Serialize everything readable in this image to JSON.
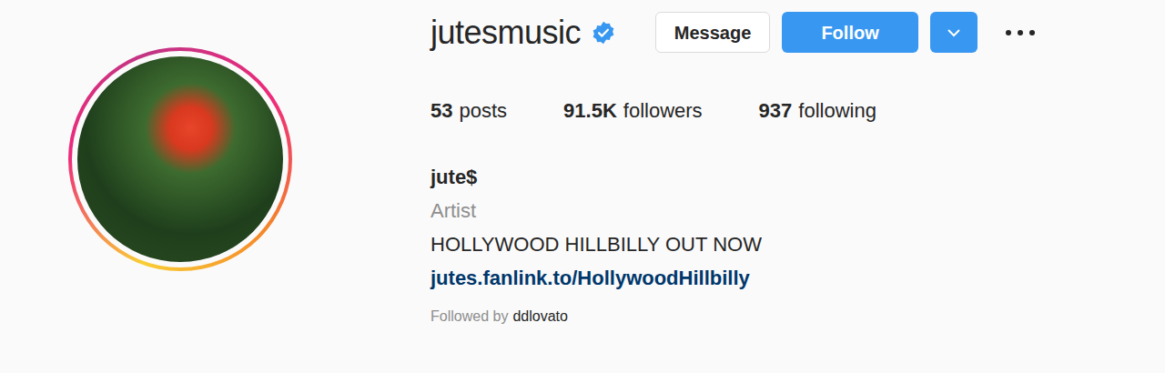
{
  "profile": {
    "username": "jutesmusic",
    "verified": true
  },
  "actions": {
    "message": "Message",
    "follow": "Follow"
  },
  "stats": [
    {
      "value": "53",
      "label": "posts"
    },
    {
      "value": "91.5K",
      "label": "followers"
    },
    {
      "value": "937",
      "label": "following"
    }
  ],
  "bio": {
    "name": "jute$",
    "category": "Artist",
    "text": "HOLLYWOOD HILLBILLY OUT NOW",
    "link": "jutes.fanlink.to/HollywoodHillbilly"
  },
  "followed_by": {
    "prefix": "Followed by",
    "user": "ddlovato"
  }
}
